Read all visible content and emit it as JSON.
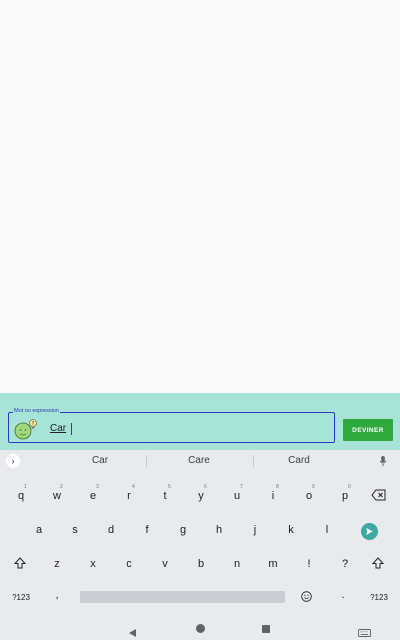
{
  "input": {
    "label": "Mot ou expression",
    "value": "Car",
    "icon": "idea-smiley-icon"
  },
  "guess_button": {
    "label": "DEVINER"
  },
  "suggestions": [
    "Car",
    "Care",
    "Card"
  ],
  "keyboard": {
    "row1": [
      "q",
      "w",
      "e",
      "r",
      "t",
      "y",
      "u",
      "i",
      "o",
      "p"
    ],
    "row1_hints": [
      "1",
      "2",
      "3",
      "4",
      "5",
      "6",
      "7",
      "8",
      "9",
      "0"
    ],
    "row2": [
      "a",
      "s",
      "d",
      "f",
      "g",
      "h",
      "j",
      "k",
      "l"
    ],
    "row3": [
      "z",
      "x",
      "c",
      "v",
      "b",
      "n",
      "m",
      "!",
      "?"
    ],
    "symbols_label": "?123",
    "comma": ",",
    "period": ".",
    "symbols_label_right": "?123"
  },
  "colors": {
    "input_bar_bg": "#a7e3d6",
    "field_border": "#2b3bbd",
    "guess_button_bg": "#2fa83e",
    "enter_key_bg": "#3fa8a0",
    "keyboard_bg": "#e8eaed"
  }
}
